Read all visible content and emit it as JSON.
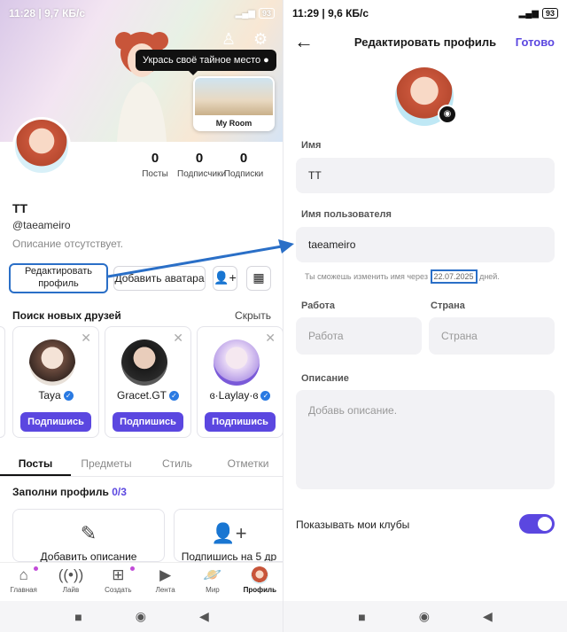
{
  "left": {
    "status": {
      "time": "11:28",
      "speed": "9,7 КБ/с",
      "battery": "93"
    },
    "tooltip": "Укрась своё тайное место",
    "my_room_label": "My Room",
    "stats": [
      {
        "value": "0",
        "label": "Посты"
      },
      {
        "value": "0",
        "label": "Подписчики"
      },
      {
        "value": "0",
        "label": "Подписки"
      }
    ],
    "username": "TT",
    "handle": "@taeameiro",
    "description": "Описание отсутствует.",
    "edit_profile": "Редактировать профиль",
    "add_avatar": "Добавить аватара",
    "find_friends": "Поиск новых друзей",
    "hide": "Скрыть",
    "friends": [
      {
        "name": "Taya",
        "button": "Подпишись"
      },
      {
        "name": "Gracet.GT",
        "button": "Подпишись"
      },
      {
        "name": "ɞ·Laylay·ɞ",
        "button": "Подпишись"
      }
    ],
    "tabs": [
      "Посты",
      "Предметы",
      "Стиль",
      "Отметки"
    ],
    "fill_profile": "Заполни профиль",
    "fill_count": "0/3",
    "fill_cards": [
      {
        "label": "Добавить описание"
      },
      {
        "label": "Подпишись на 5 др"
      }
    ],
    "bottom_nav": [
      "Главная",
      "Лайв",
      "Создать",
      "Лента",
      "Мир",
      "Профиль"
    ]
  },
  "right": {
    "status": {
      "time": "11:29",
      "speed": "9,6 КБ/с",
      "battery": "93"
    },
    "title": "Редактировать профиль",
    "done": "Готово",
    "name_label": "Имя",
    "name_value": "TT",
    "username_label": "Имя пользователя",
    "username_value": "taeameiro",
    "hint_before": "Ты сможешь изменить имя через",
    "hint_date": "22.07.2025",
    "hint_after": "дней.",
    "work_label": "Работа",
    "work_placeholder": "Работа",
    "country_label": "Страна",
    "country_placeholder": "Страна",
    "about_label": "Описание",
    "about_placeholder": "Добавь описание.",
    "clubs_label": "Показывать мои клубы",
    "clubs_toggle_on": true
  },
  "colors": {
    "accent": "#5b47e0",
    "highlight": "#2a6fc7",
    "verified": "#2a7ae2"
  }
}
